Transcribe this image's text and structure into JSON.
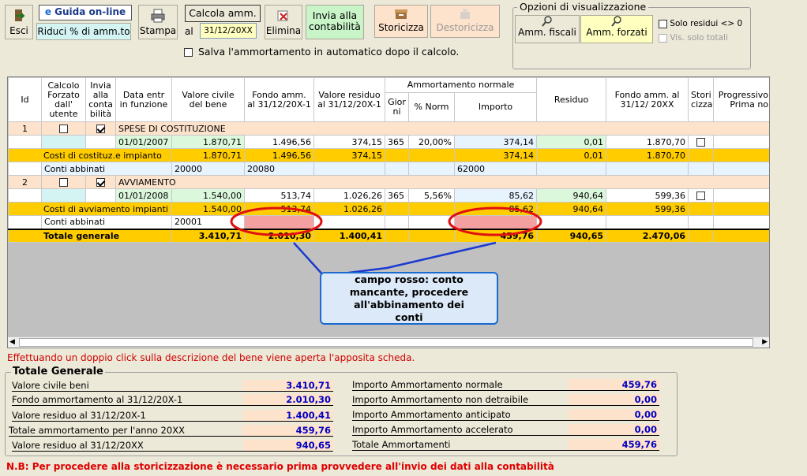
{
  "toolbar": {
    "esci": "Esci",
    "guida": "Guida on-line",
    "riduci": "Riduci % di amm.to",
    "stampa": "Stampa",
    "calcola": "Calcola amm.",
    "al": "al",
    "date": "31/12/20XX",
    "elimina": "Elimina",
    "invia": "Invia alla contabilità",
    "storicizza": "Storicizza",
    "destoricizza": "Destoricizza",
    "salva": "Salva l'ammortamento in automatico dopo il calcolo."
  },
  "opzioni": {
    "title": "Opzioni di visualizzazione",
    "fiscali": "Amm. fiscali",
    "forzati": "Amm. forzati",
    "solo_residui": "Solo residui <> 0",
    "vis_totali": "Vis. solo totali"
  },
  "headers": {
    "id": "Id",
    "calcolo": "Calcolo Forzato dall' utente",
    "invia": "Invia alla conta bilità",
    "data": "Data entr in funzione",
    "valore_civile": "Valore civile del bene",
    "fondo": "Fondo amm. al 31/12/20X-1",
    "valore_residuo": "Valore residuo al 31/12/20X-1",
    "amm_normale": "Ammortamento normale",
    "giorni": "Gior ni",
    "norm": "% Norm",
    "importo": "Importo",
    "residuo": "Residuo",
    "fondo_al": "Fondo amm. al 31/12/ 20XX",
    "stori": "Stori cizza",
    "progressivo": "Progressivo Prima no"
  },
  "rows": [
    {
      "id": "1",
      "name": "SPESE DI COSTITUZIONE",
      "date": "01/01/2007",
      "valore": "1.870,71",
      "fondo": "1.496,56",
      "residuo": "374,15",
      "giorni": "365",
      "norm": "20,00%",
      "importo": "374,14",
      "res": "0,01",
      "fondo_al": "1.870,70",
      "sub": {
        "label": "Costi di costituz.e impianto",
        "valore": "1.870,71",
        "fondo": "1.496,56",
        "residuo": "374,15",
        "importo": "374,14",
        "res": "0,01",
        "fondo_al": "1.870,70"
      },
      "conti": {
        "label": "Conti abbinati",
        "c1": "20000",
        "c2": "20080",
        "c3": "62000"
      }
    },
    {
      "id": "2",
      "name": "AVVIAMENTO",
      "date": "01/01/2008",
      "valore": "1.540,00",
      "fondo": "513,74",
      "residuo": "1.026,26",
      "giorni": "365",
      "norm": "5,56%",
      "importo": "85,62",
      "res": "940,64",
      "fondo_al": "599,36",
      "sub": {
        "label": "Costi di avviamento impianti",
        "valore": "1.540,00",
        "fondo": "513,74",
        "residuo": "1.026,26",
        "importo": "85,62",
        "res": "940,64",
        "fondo_al": "599,36"
      },
      "conti": {
        "label": "Conti abbinati",
        "c1": "20001",
        "c2": "",
        "c3": ""
      }
    }
  ],
  "totale": {
    "label": "Totale generale",
    "valore": "3.410,71",
    "fondo": "2.010,30",
    "residuo": "1.400,41",
    "importo": "459,76",
    "res": "940,65",
    "fondo_al": "2.470,06"
  },
  "callout": "campo rosso: conto mancante, procedere all'abbinamento dei conti",
  "hint": "Effettuando un doppio click sulla descrizione del bene viene aperta l'apposita scheda.",
  "summary": {
    "title": "Totale Generale",
    "left": [
      {
        "label": "Valore civile beni",
        "value": "3.410,71"
      },
      {
        "label": "Fondo ammortamento al 31/12/20X-1",
        "value": "2.010,30"
      },
      {
        "label": "Valore residuo al 31/12/20X-1",
        "value": "1.400,41"
      },
      {
        "label": "Totale ammortamento per l'anno 20XX",
        "value": "459,76"
      },
      {
        "label": "Valore residuo al 31/12/20XX",
        "value": "940,65"
      }
    ],
    "right": [
      {
        "label": "Importo Ammortamento normale",
        "value": "459,76"
      },
      {
        "label": "Importo Ammortamento non detraibile",
        "value": "0,00"
      },
      {
        "label": "Importo Ammortamento anticipato",
        "value": "0,00"
      },
      {
        "label": "Importo Ammortamento accelerato",
        "value": "0,00"
      },
      {
        "label": "Totale Ammortamenti",
        "value": "459,76"
      }
    ]
  },
  "note": "N.B: Per procedere alla storicizzazione è necessario prima provvedere all'invio dei dati alla contabilità"
}
